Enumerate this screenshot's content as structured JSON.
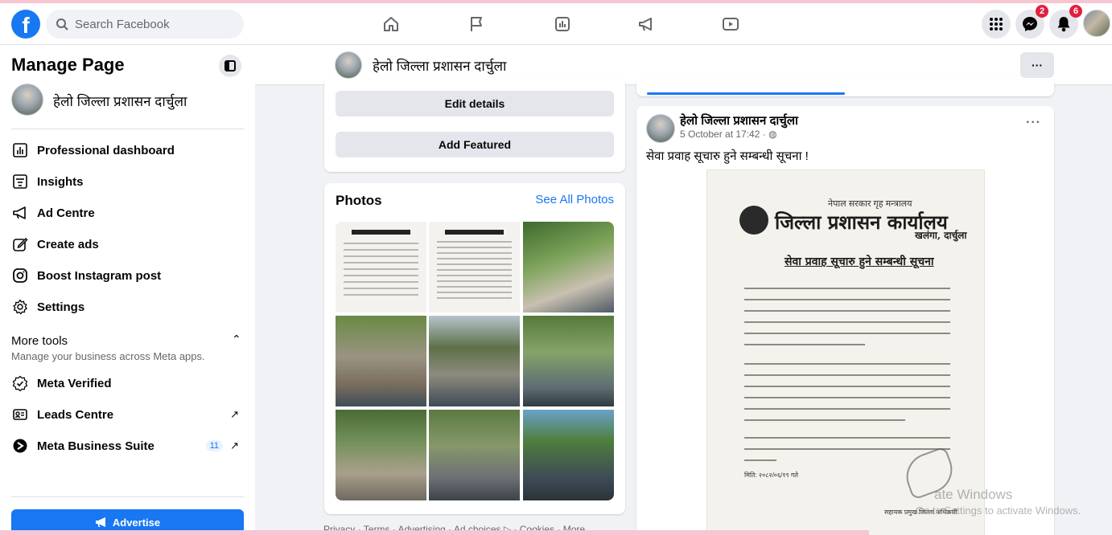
{
  "header": {
    "search_placeholder": "Search Facebook",
    "messenger_badge": "2",
    "notifications_badge": "6"
  },
  "sidebar": {
    "title": "Manage Page",
    "page_name": "हेलो जिल्ला प्रशासन दार्चुला",
    "items": [
      {
        "label": "Professional dashboard",
        "icon": "dashboard-icon"
      },
      {
        "label": "Insights",
        "icon": "insights-icon"
      },
      {
        "label": "Ad Centre",
        "icon": "megaphone-icon"
      },
      {
        "label": "Create ads",
        "icon": "pencil-icon"
      },
      {
        "label": "Boost Instagram post",
        "icon": "instagram-icon"
      },
      {
        "label": "Settings",
        "icon": "gear-icon"
      }
    ],
    "more_tools": {
      "title": "More tools",
      "subtitle": "Manage your business across Meta apps.",
      "items": [
        {
          "label": "Meta Verified",
          "icon": "verified-icon"
        },
        {
          "label": "Leads Centre",
          "icon": "leads-icon"
        },
        {
          "label": "Meta Business Suite",
          "icon": "meta-business-icon",
          "count": "11"
        }
      ]
    },
    "advertise_label": "Advertise"
  },
  "pagebar": {
    "page_name": "हेलो जिल्ला प्रशासन दार्चुला",
    "more_label": "···"
  },
  "left_column": {
    "edit_details": "Edit details",
    "add_featured": "Add Featured",
    "photos_title": "Photos",
    "see_all": "See All Photos",
    "footer": "Privacy · Terms · Advertising · Ad choices ▷ · Cookies · More"
  },
  "post": {
    "author": "हेलो जिल्ला प्रशासन दार्चुला",
    "time": "5 October at 17:42 · ",
    "text": "सेवा प्रवाह सूचारु हुने सम्बन्धी सूचना !",
    "more_label": "···",
    "image": {
      "ministry": "नेपाल सरकार गृह मन्त्रालय",
      "office": "जिल्ला प्रशासन कार्यालय",
      "place": "खलंगा, दार्चुला",
      "title": "सेवा प्रवाह सूचारु हुने सम्बन्धी सूचना",
      "date": "मिति: २०८२/०६/१९ गते",
      "officer": "सहायक प्रमुख जिल्ला अधिकारी"
    }
  },
  "watermark": {
    "line1": "ate Windows",
    "line2": "Go to Settings to activate Windows."
  },
  "colors": {
    "brand": "#1877f2",
    "badge": "#e41e3f",
    "background": "#f0f2f5"
  }
}
